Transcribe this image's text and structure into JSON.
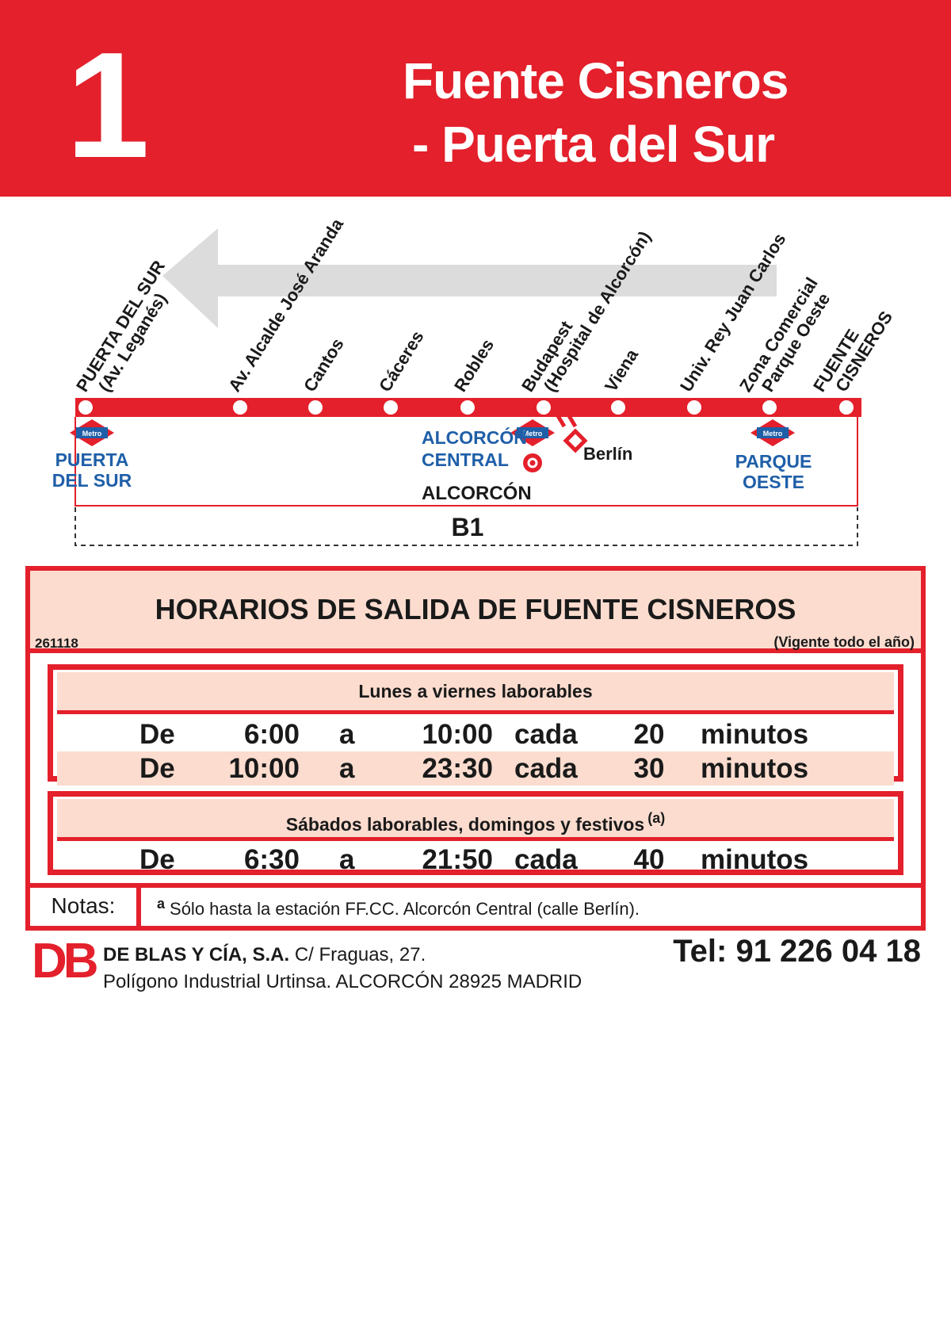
{
  "header": {
    "line_number": "1",
    "title_line1": "Fuente Cisneros",
    "title_line2": "- Puerta del Sur"
  },
  "route_map": {
    "stops": [
      {
        "name": "PUERTA DEL SUR",
        "sub": "(Av. Leganés)"
      },
      {
        "name": "Av. Alcalde José Aranda",
        "sub": ""
      },
      {
        "name": "Cantos",
        "sub": ""
      },
      {
        "name": "Cáceres",
        "sub": ""
      },
      {
        "name": "Robles",
        "sub": ""
      },
      {
        "name": "Budapest",
        "sub": "(Hospital de Alcorcón)"
      },
      {
        "name": "Viena",
        "sub": ""
      },
      {
        "name": "Univ. Rey Juan Carlos",
        "sub": ""
      },
      {
        "name": "Zona Comercial",
        "sub": "Parque Oeste"
      },
      {
        "name": "FUENTE",
        "sub": "CISNEROS"
      }
    ],
    "metro_badge": "Metro",
    "connections": {
      "puerta_del_sur": [
        "PUERTA",
        "DEL SUR"
      ],
      "alcorcon_central": [
        "ALCORCÓN",
        "CENTRAL"
      ],
      "berlin": "Berlín",
      "parque_oeste": [
        "PARQUE",
        "OESTE"
      ]
    },
    "zone_label": "ALCORCÓN",
    "fare_zone": "B1",
    "colors": {
      "line": "#e3202b",
      "metro": "#1f5fa8",
      "arrow": "#dcdcdc"
    }
  },
  "schedule": {
    "title": "HORARIOS DE SALIDA DE FUENTE CISNEROS",
    "code": "261118",
    "validity": "(Vigente todo el año)",
    "weekday": {
      "heading": "Lunes a viernes laborables",
      "rows": [
        {
          "de": "De",
          "from": "6:00",
          "a": "a",
          "to": "10:00",
          "cada": "cada",
          "freq": "20",
          "unit": "minutos"
        },
        {
          "de": "De",
          "from": "10:00",
          "a": "a",
          "to": "23:30",
          "cada": "cada",
          "freq": "30",
          "unit": "minutos"
        }
      ]
    },
    "weekend": {
      "heading": "Sábados laborables, domingos y festivos",
      "heading_note": "(a)",
      "rows": [
        {
          "de": "De",
          "from": "6:30",
          "a": "a",
          "to": "21:50",
          "cada": "cada",
          "freq": "40",
          "unit": "minutos"
        }
      ]
    },
    "notes": {
      "label": "Notas:",
      "mark": "a",
      "text": "Sólo hasta la estación FF.CC. Alcorcón Central (calle Berlín)."
    }
  },
  "footer": {
    "logo": "DB",
    "company": "DE BLAS Y CÍA, S.A.",
    "street": "C/ Fraguas, 27.",
    "address2": "Polígono Industrial Urtinsa. ALCORCÓN 28925 MADRID",
    "tel": "Tel: 91 226 04 18"
  }
}
